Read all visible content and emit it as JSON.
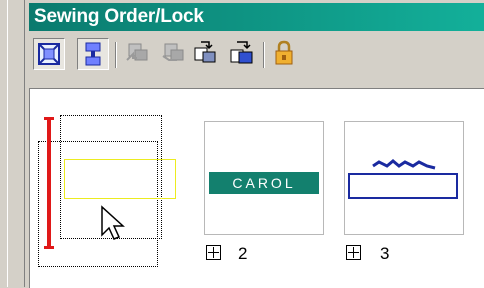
{
  "window": {
    "title": "Sewing Order/Lock"
  },
  "toolbar": {
    "buttons": [
      {
        "icon": "fit-view-icon"
      },
      {
        "icon": "select-order-icon"
      },
      {
        "icon": "move-front-icon"
      },
      {
        "icon": "move-back-icon"
      },
      {
        "icon": "forward-icon"
      },
      {
        "icon": "backward-icon"
      },
      {
        "icon": "lock-icon"
      }
    ]
  },
  "thumbnails": [
    {
      "label": "",
      "number": ""
    },
    {
      "label": "CAROL",
      "number": "2"
    },
    {
      "label": "",
      "number": "3"
    }
  ],
  "colors": {
    "title_bar": "#0a7a6e",
    "carol_fill": "#13806e",
    "selection_red": "#e01818",
    "embroidery_blue": "#1a2aa0"
  }
}
